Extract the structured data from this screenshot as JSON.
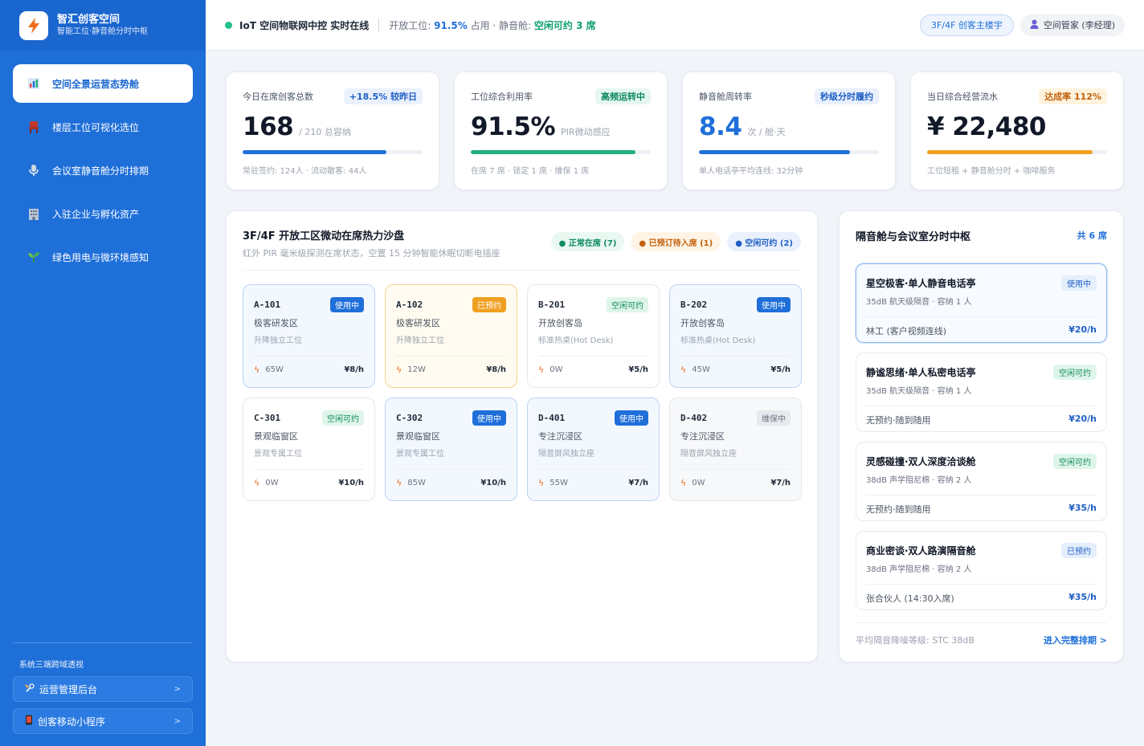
{
  "brand": {
    "title": "智汇创客空间",
    "subtitle": "智能工位·静音舱分时中枢"
  },
  "nav": [
    {
      "icon": "bar-chart-icon",
      "label": "空间全景运营态势舱"
    },
    {
      "icon": "chair-icon",
      "label": "楼层工位可视化选位"
    },
    {
      "icon": "microphone-icon",
      "label": "会议室静音舱分时排期"
    },
    {
      "icon": "building-icon",
      "label": "入驻企业与孵化资产"
    },
    {
      "icon": "sprout-icon",
      "label": "绿色用电与微环境感知"
    }
  ],
  "sidebar_bottom": {
    "title": "系统三端跨域透视",
    "links": [
      {
        "icon": "tools-icon",
        "label": "运营管理后台",
        "arrow": ">"
      },
      {
        "icon": "mobile-icon",
        "label": "创客移动小程序",
        "arrow": ">"
      }
    ]
  },
  "header": {
    "status": "IoT 空间物联网中控 实时在线",
    "metric_prefix": "开放工位: ",
    "metric_value": "91.5%",
    "metric_mid": " 占用 · 静音舱: ",
    "metric_free": "空闲可约 3 席",
    "floor": "3F/4F 创客主楼宇",
    "user": "空间管家 (李经理)"
  },
  "kpis": [
    {
      "title": "今日在席创客总数",
      "badge": "+18.5% 较昨日",
      "value": "168",
      "unit": "/ 210 总容纳",
      "progress": 0.8,
      "foot": "常驻签约: 124人 · 流动散客: 44人"
    },
    {
      "title": "工位综合利用率",
      "badge": "高频运转中",
      "value": "91.5%",
      "unit": "PIR微动感应",
      "progress": 0.915,
      "foot": "在席 7 席 · 锁定 1 席 · 维保 1 席"
    },
    {
      "title": "静音舱周转率",
      "badge": "秒级分时履约",
      "value": "8.4",
      "unit": "次 / 舱·天",
      "progress": 0.84,
      "foot": "单人电话亭平均连线: 32分钟"
    },
    {
      "title": "当日综合经营流水",
      "badge": "达成率 112%",
      "value": "¥ 22,480",
      "unit": "",
      "progress": 0.92,
      "foot": "工位短租 + 静音舱分时 + 咖啡服务"
    }
  ],
  "colors": {
    "kpi_fill": [
      "#1f6fd9",
      "#22b07d",
      "#1f6fd9",
      "#f0a020"
    ],
    "kpi_badge_bg": [
      "#eaf1fd",
      "#e6f7ef",
      "#eaf1fd",
      "#fff3de"
    ],
    "kpi_badge_fg": [
      "#1f5fc4",
      "#0e8a5f",
      "#1f5fc4",
      "#c2610c"
    ],
    "kpi_value_fg": [
      "#111827",
      "#111827",
      "#1f6fd9",
      "#111827"
    ]
  },
  "heatmap": {
    "title": "3F/4F 开放工区微动在席热力沙盘",
    "subtitle": "红外 PIR 毫米级探测在席状态，空置 15 分钟智能休眠切断电插座",
    "legend": [
      {
        "label": "● 正常在席 (7)",
        "style": "green"
      },
      {
        "label": "● 已预订待入席 (1)",
        "style": "orange"
      },
      {
        "label": "● 空闲可约 (2)",
        "style": "blue"
      }
    ],
    "seats": [
      {
        "id": "A-101",
        "status": "使用中",
        "state": "busy",
        "zone": "极客研发区",
        "type": "升降独立工位",
        "power": "65W",
        "price": "¥8/h"
      },
      {
        "id": "A-102",
        "status": "已预约",
        "state": "booked",
        "zone": "极客研发区",
        "type": "升降独立工位",
        "power": "12W",
        "price": "¥8/h"
      },
      {
        "id": "B-201",
        "status": "空闲可约",
        "state": "free",
        "zone": "开放创客岛",
        "type": "标准热桌(Hot Desk)",
        "power": "0W",
        "price": "¥5/h"
      },
      {
        "id": "B-202",
        "status": "使用中",
        "state": "busy",
        "zone": "开放创客岛",
        "type": "标准热桌(Hot Desk)",
        "power": "45W",
        "price": "¥5/h"
      },
      {
        "id": "C-301",
        "status": "空闲可约",
        "state": "free",
        "zone": "景观临窗区",
        "type": "景观专属工位",
        "power": "0W",
        "price": "¥10/h"
      },
      {
        "id": "C-302",
        "status": "使用中",
        "state": "busy",
        "zone": "景观临窗区",
        "type": "景观专属工位",
        "power": "85W",
        "price": "¥10/h"
      },
      {
        "id": "D-401",
        "status": "使用中",
        "state": "busy",
        "zone": "专注沉浸区",
        "type": "隔音屏风独立座",
        "power": "55W",
        "price": "¥7/h"
      },
      {
        "id": "D-402",
        "status": "维保中",
        "state": "maint",
        "zone": "专注沉浸区",
        "type": "隔音屏风独立座",
        "power": "0W",
        "price": "¥7/h"
      }
    ]
  },
  "pods_panel": {
    "title": "隔音舱与会议室分时中枢",
    "count": "共 6 席",
    "pods": [
      {
        "name": "星空极客·单人静音电话亭",
        "status": "使用中",
        "state": "busy",
        "spec": "35dB 航天级隔音 · 容纳 1 人",
        "user": "林工 (客户视频连线)",
        "price": "¥20/h",
        "active": true
      },
      {
        "name": "静谧思绪·单人私密电话亭",
        "status": "空闲可约",
        "state": "free",
        "spec": "35dB 航天级隔音 · 容纳 1 人",
        "user": "无预约·随到随用",
        "price": "¥20/h",
        "active": false
      },
      {
        "name": "灵感碰撞·双人深度洽谈舱",
        "status": "空闲可约",
        "state": "free",
        "spec": "38dB 声学阻尼棉 · 容纳 2 人",
        "user": "无预约·随到随用",
        "price": "¥35/h",
        "active": false
      },
      {
        "name": "商业密谈·双人路演隔音舱",
        "status": "已预约",
        "state": "booked",
        "spec": "38dB 声学阻尼棉 · 容纳 2 人",
        "user": "张合伙人 (14:30入席)",
        "price": "¥35/h",
        "active": false
      }
    ],
    "footer_left": "平均隔音降噪等级: STC 38dB",
    "footer_right": "进入完整排期 >"
  }
}
